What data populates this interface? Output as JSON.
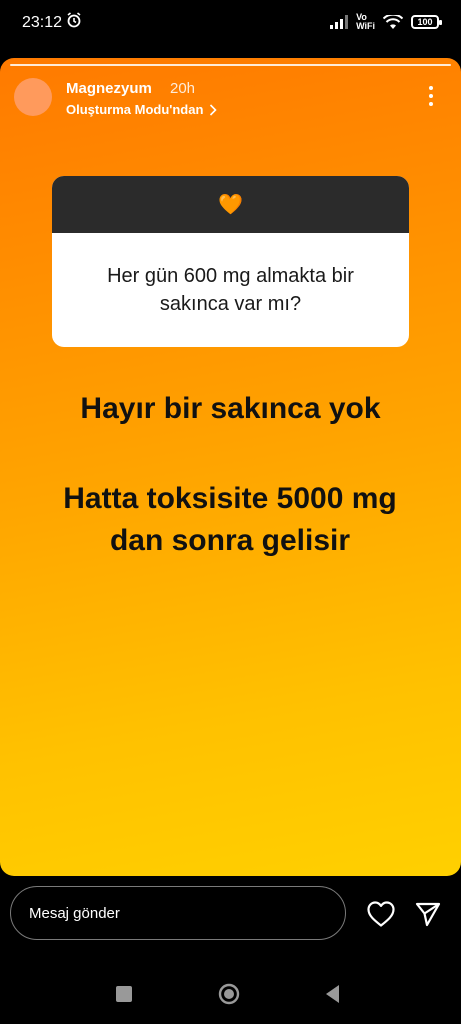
{
  "status_bar": {
    "time": "23:12",
    "network": "Vo\nWiFi",
    "battery": "100"
  },
  "story": {
    "username": "Magnezyum",
    "time_ago": "20h",
    "source": "Oluşturma Modu'ndan",
    "question": "Her gün 600 mg almakta bir sakınca var mı?",
    "answer_line1": "Hayır bir sakınca yok",
    "answer_line2": "Hatta toksisite 5000 mg dan sonra gelisir",
    "background_colors": [
      "#ff7a00",
      "#ffd000"
    ],
    "question_emoji": "🧡"
  },
  "reply": {
    "placeholder": "Mesaj gönder"
  },
  "icons": {
    "like": "heart-icon",
    "share": "send-icon",
    "menu": "more-vertical-icon"
  }
}
